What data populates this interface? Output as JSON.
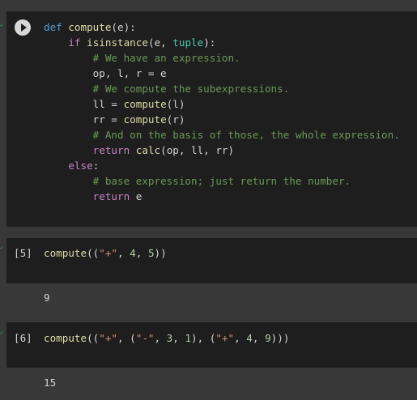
{
  "cells": [
    {
      "lines": [
        [
          {
            "t": "def",
            "c": "kwb"
          },
          {
            "t": " "
          },
          {
            "t": "compute",
            "c": "fn"
          },
          {
            "t": "(e):"
          }
        ],
        [
          {
            "t": "    "
          },
          {
            "t": "if",
            "c": "kw"
          },
          {
            "t": " "
          },
          {
            "t": "isinstance",
            "c": "fn"
          },
          {
            "t": "(e, "
          },
          {
            "t": "tuple",
            "c": "bi"
          },
          {
            "t": "):"
          }
        ],
        [
          {
            "t": "        "
          },
          {
            "t": "# We have an expression.",
            "c": "cm"
          }
        ],
        [
          {
            "t": "        op, l, r = e"
          }
        ],
        [
          {
            "t": "        "
          },
          {
            "t": "# We compute the subexpressions.",
            "c": "cm"
          }
        ],
        [
          {
            "t": "        ll = "
          },
          {
            "t": "compute",
            "c": "fn"
          },
          {
            "t": "(l)"
          }
        ],
        [
          {
            "t": "        rr = "
          },
          {
            "t": "compute",
            "c": "fn"
          },
          {
            "t": "(r)"
          }
        ],
        [
          {
            "t": "        "
          },
          {
            "t": "# And on the basis of those, the whole expression.",
            "c": "cm"
          }
        ],
        [
          {
            "t": "        "
          },
          {
            "t": "return",
            "c": "kw"
          },
          {
            "t": " "
          },
          {
            "t": "calc",
            "c": "fn"
          },
          {
            "t": "(op, ll, rr)"
          }
        ],
        [
          {
            "t": "    "
          },
          {
            "t": "else",
            "c": "kw"
          },
          {
            "t": ":"
          }
        ],
        [
          {
            "t": "        "
          },
          {
            "t": "# base expression; just return the number.",
            "c": "cm"
          }
        ],
        [
          {
            "t": "        "
          },
          {
            "t": "return",
            "c": "kw"
          },
          {
            "t": " e"
          }
        ]
      ]
    },
    {
      "exec_count": "[5]",
      "lines": [
        [
          {
            "t": "compute",
            "c": "fn"
          },
          {
            "t": "(("
          },
          {
            "t": "\"+\"",
            "c": "str"
          },
          {
            "t": ", "
          },
          {
            "t": "4",
            "c": "num"
          },
          {
            "t": ", "
          },
          {
            "t": "5",
            "c": "num"
          },
          {
            "t": "))"
          }
        ]
      ],
      "output": "9"
    },
    {
      "exec_count": "[6]",
      "lines": [
        [
          {
            "t": "compute",
            "c": "fn"
          },
          {
            "t": "(("
          },
          {
            "t": "\"+\"",
            "c": "str"
          },
          {
            "t": ", ("
          },
          {
            "t": "\"-\"",
            "c": "str"
          },
          {
            "t": ", "
          },
          {
            "t": "3",
            "c": "num"
          },
          {
            "t": ", "
          },
          {
            "t": "1",
            "c": "num"
          },
          {
            "t": "), ("
          },
          {
            "t": "\"+\"",
            "c": "str"
          },
          {
            "t": ", "
          },
          {
            "t": "4",
            "c": "num"
          },
          {
            "t": ", "
          },
          {
            "t": "9",
            "c": "num"
          },
          {
            "t": ")))"
          }
        ]
      ],
      "output": "15"
    }
  ]
}
